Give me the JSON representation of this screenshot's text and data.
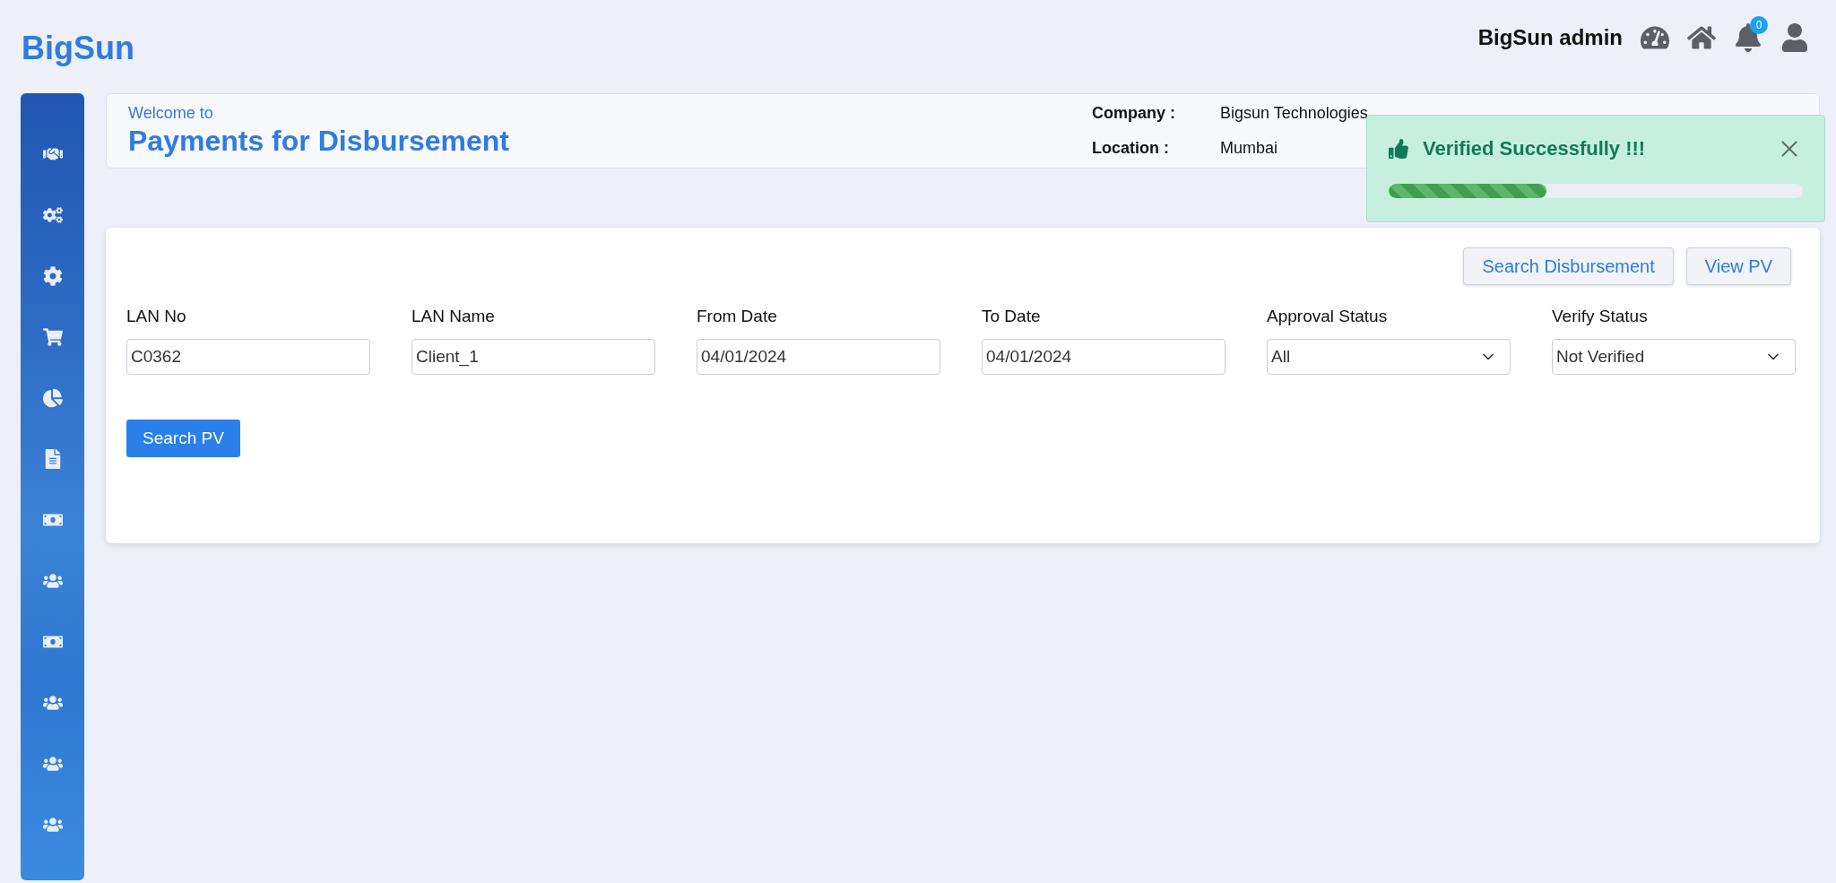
{
  "brand": "BigSun",
  "topbar": {
    "user": "BigSun admin",
    "notifications": "0"
  },
  "sidebar": {
    "items": [
      {
        "kind": "handshake"
      },
      {
        "kind": "cogs"
      },
      {
        "kind": "cog"
      },
      {
        "kind": "cart"
      },
      {
        "kind": "pie"
      },
      {
        "kind": "file"
      },
      {
        "kind": "money"
      },
      {
        "kind": "users"
      },
      {
        "kind": "money"
      },
      {
        "kind": "users"
      },
      {
        "kind": "users"
      },
      {
        "kind": "users"
      }
    ]
  },
  "header": {
    "welcome": "Welcome to",
    "title": "Payments for Disbursement",
    "info": [
      {
        "label": "Company :",
        "value": "Bigsun Technologies"
      },
      {
        "label": "Location :",
        "value": "Mumbai"
      }
    ]
  },
  "toast": {
    "message": "Verified Successfully !!!",
    "level": 0.38
  },
  "actions": [
    "Search Disbursement",
    "View PV"
  ],
  "filters": [
    {
      "kind": "text",
      "label": "LAN No",
      "value": "C0362"
    },
    {
      "kind": "text",
      "label": "LAN Name",
      "value": "Client_1"
    },
    {
      "kind": "text",
      "label": "From Date",
      "value": "04/01/2024"
    },
    {
      "kind": "text",
      "label": "To Date",
      "value": "04/01/2024"
    },
    {
      "kind": "select",
      "label": "Approval Status",
      "value": "All"
    },
    {
      "kind": "select",
      "label": "Verify Status",
      "value": "Not Verified"
    }
  ],
  "search_button": "Search PV"
}
